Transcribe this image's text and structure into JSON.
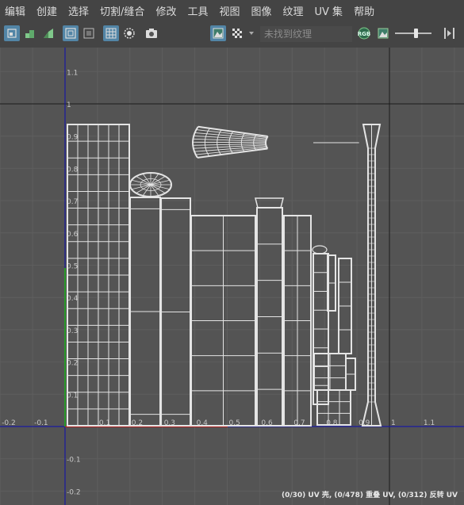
{
  "menubar": {
    "items": [
      "编辑",
      "创建",
      "选择",
      "切割/缝合",
      "修改",
      "工具",
      "视图",
      "图像",
      "纹理",
      "UV 集",
      "帮助"
    ]
  },
  "toolbar": {
    "texture_placeholder": "未找到纹理",
    "icons": [
      "uv-shell-select-icon",
      "uv-grid-snap-icon",
      "uv-distort-icon",
      "isolate-select-icon",
      "frame-icon",
      "checker-grid-icon",
      "shaded-circle-icon",
      "snapshot-icon",
      "image-display-icon",
      "checker-pattern-icon",
      "dropdown-arrow-icon",
      "rgb-channels-icon",
      "alpha-image-icon",
      "exposure-slider",
      "gamma-arrows-icon"
    ]
  },
  "viewport": {
    "axis_labels_x": [
      "-0.2",
      "-0.1",
      "0.1",
      "0.2",
      "0.3",
      "0.4",
      "0.5",
      "0.6",
      "0.7",
      "0.8",
      "0.9",
      "1",
      "1.1"
    ],
    "axis_labels_y": [
      "1.1",
      "1",
      "0.9",
      "0.8",
      "0.7",
      "0.6",
      "0.5",
      "0.4",
      "0.3",
      "0.2",
      "0.1",
      "-0.1",
      "-0.2"
    ],
    "status_text": "(0/30) UV 壳, (0/478) 重叠 UV, (0/312) 反转 UV"
  }
}
